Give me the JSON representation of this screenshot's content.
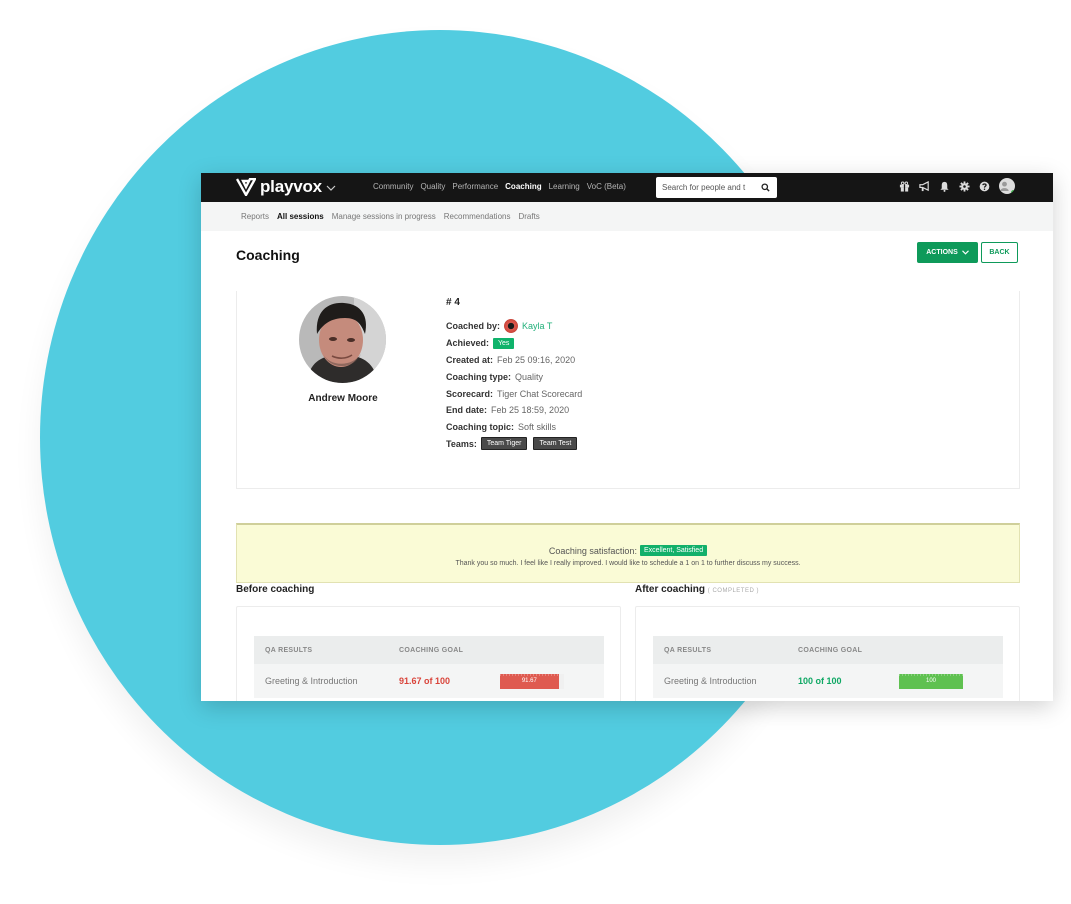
{
  "app": {
    "brand": "playvox",
    "nav": [
      "Community",
      "Quality",
      "Performance",
      "Coaching",
      "Learning",
      "VoC (Beta)"
    ],
    "active_nav": "Coaching",
    "search_placeholder": "Search for people and t",
    "tool_icons": [
      "gift-icon",
      "megaphone-icon",
      "bell-icon",
      "gear-icon",
      "help-icon",
      "user-avatar"
    ]
  },
  "subnav": {
    "items": [
      "Reports",
      "All sessions",
      "Manage sessions in progress",
      "Recommendations",
      "Drafts"
    ],
    "active": "All sessions"
  },
  "page": {
    "title": "Coaching",
    "actions_label": "ACTIONS",
    "back_label": "BACK"
  },
  "session": {
    "person_name": "Andrew Moore",
    "number": "# 4",
    "coached_by_label": "Coached by:",
    "coached_by": "Kayla T",
    "achieved_label": "Achieved:",
    "achieved": "Yes",
    "created_label": "Created at:",
    "created": "Feb 25 09:16, 2020",
    "type_label": "Coaching type:",
    "type": "Quality",
    "scorecard_label": "Scorecard:",
    "scorecard": "Tiger Chat Scorecard",
    "end_label": "End date:",
    "end": "Feb 25 18:59, 2020",
    "topic_label": "Coaching topic:",
    "topic": "Soft skills",
    "teams_label": "Teams:",
    "teams": [
      "Team Tiger",
      "Team Test"
    ]
  },
  "satisfaction": {
    "label": "Coaching satisfaction:",
    "rating": "Excellent, Satisfied",
    "comment": "Thank you so much. I feel like I really improved. I would like to schedule a 1 on 1 to further discuss my success."
  },
  "before": {
    "title": "Before coaching",
    "col1": "QA RESULTS",
    "col2": "COACHING GOAL",
    "row": {
      "name": "Greeting & Introduction",
      "score": "91.67 of 100",
      "bar_label": "91.67",
      "percent": 91.67
    }
  },
  "after": {
    "title": "After coaching",
    "status": "( COMPLETED )",
    "col1": "QA RESULTS",
    "col2": "COACHING GOAL",
    "row": {
      "name": "Greeting & Introduction",
      "score": "100 of 100",
      "bar_label": "100",
      "percent": 100
    }
  },
  "colors": {
    "brand_green": "#0e9a5a",
    "backdrop_circle": "#52cce0",
    "score_red": "#d9443a",
    "score_green": "#0fa864"
  }
}
